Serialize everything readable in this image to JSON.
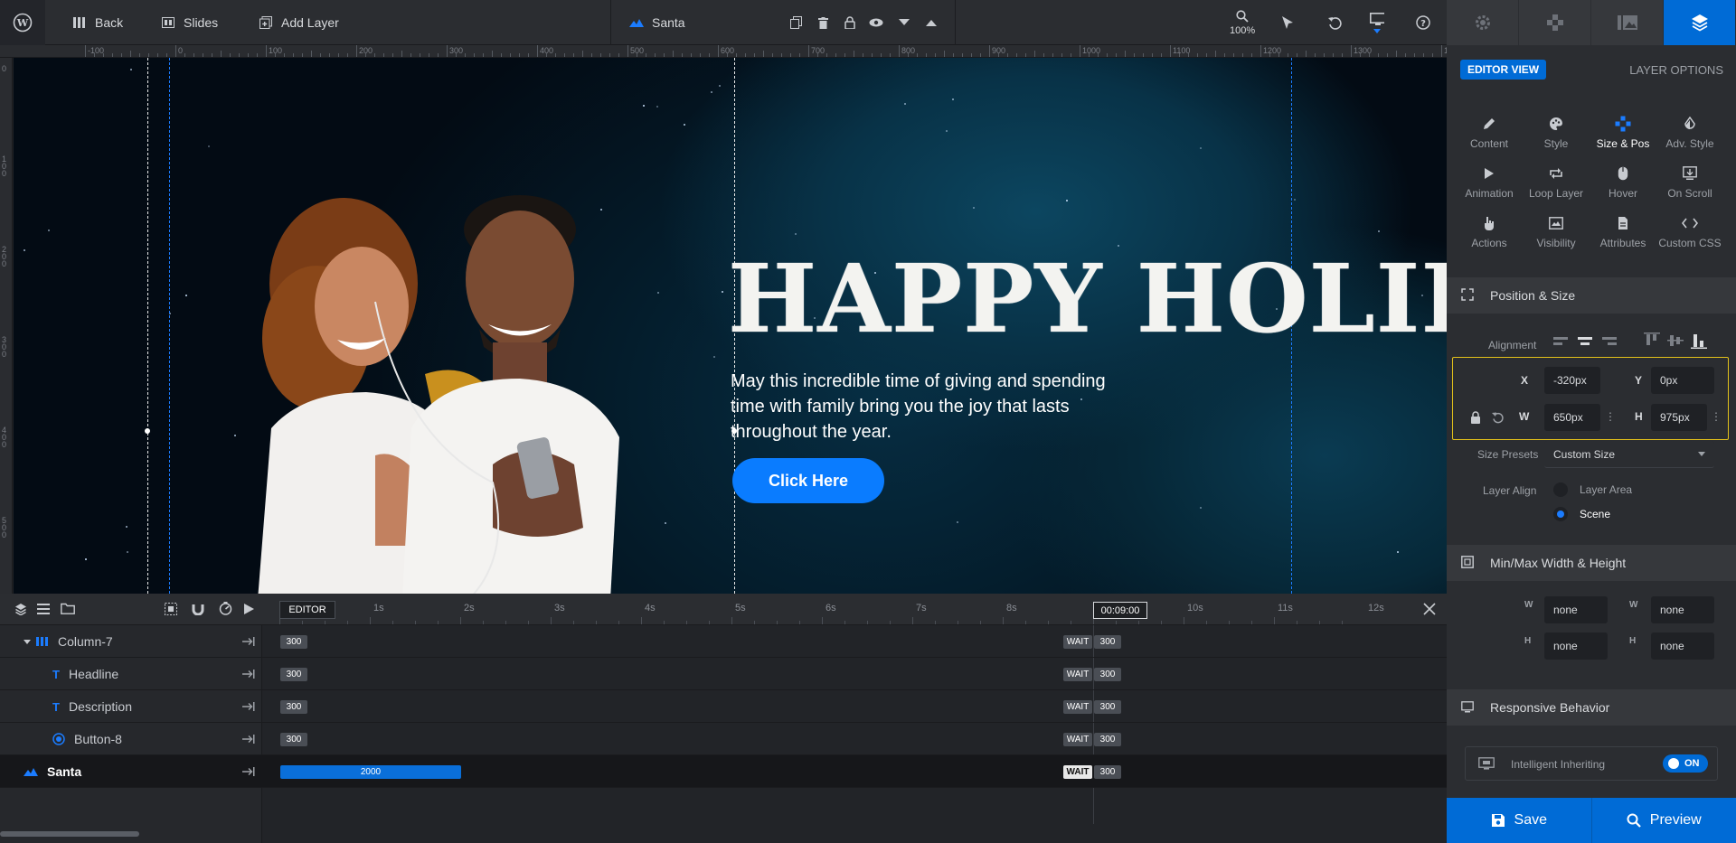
{
  "topbar": {
    "back_label": "Back",
    "slides_label": "Slides",
    "add_layer_label": "Add Layer",
    "current_slide": "Santa",
    "zoom": "100%"
  },
  "right_tabs": [
    "gear-icon",
    "move-icon",
    "gallery-icon",
    "layers-icon"
  ],
  "ruler": {
    "h_labels": [
      "-100",
      "0",
      "100",
      "200",
      "300",
      "400",
      "500",
      "600",
      "700",
      "800",
      "900",
      "1000",
      "1100",
      "1200",
      "1300",
      "14"
    ],
    "v_labels": [
      "0",
      "100",
      "200",
      "300",
      "400",
      "500"
    ]
  },
  "canvas": {
    "headline": "HAPPY HOLIDA",
    "description": "May this incredible time of giving and spending time with family bring you the joy that lasts throughout the year.",
    "button_label": "Click Here"
  },
  "timeline": {
    "editor_label": "EDITOR",
    "time_marks": [
      "1s",
      "2s",
      "3s",
      "4s",
      "5s",
      "6s",
      "7s",
      "8s",
      "9s",
      "10s",
      "11s",
      "12s"
    ],
    "current_time": "00:09:00",
    "rows": [
      {
        "name": "Column-7",
        "start": "300",
        "wait": "WAIT",
        "end": "300"
      },
      {
        "name": "Headline",
        "start": "300",
        "wait": "WAIT",
        "end": "300"
      },
      {
        "name": "Description",
        "start": "300",
        "wait": "WAIT",
        "end": "300"
      },
      {
        "name": "Button-8",
        "start": "300",
        "wait": "WAIT",
        "end": "300"
      },
      {
        "name": "Santa",
        "start": "2000",
        "wait": "WAIT",
        "end": "300"
      }
    ]
  },
  "panel": {
    "editor_view": "EDITOR VIEW",
    "layer_options": "LAYER OPTIONS",
    "tools": [
      {
        "label": "Content",
        "icon": "pencil-icon"
      },
      {
        "label": "Style",
        "icon": "palette-icon"
      },
      {
        "label": "Size & Pos",
        "icon": "size-pos-icon"
      },
      {
        "label": "Adv. Style",
        "icon": "drop-icon"
      },
      {
        "label": "Animation",
        "icon": "play-icon"
      },
      {
        "label": "Loop Layer",
        "icon": "loop-icon"
      },
      {
        "label": "Hover",
        "icon": "mouse-icon"
      },
      {
        "label": "On Scroll",
        "icon": "scroll-icon"
      },
      {
        "label": "Actions",
        "icon": "hand-icon"
      },
      {
        "label": "Visibility",
        "icon": "visibility-icon"
      },
      {
        "label": "Attributes",
        "icon": "file-icon"
      },
      {
        "label": "Custom CSS",
        "icon": "code-icon"
      }
    ],
    "pos_size": {
      "title": "Position & Size",
      "alignment_label": "Alignment",
      "x_label": "X",
      "x_value": "-320px",
      "y_label": "Y",
      "y_value": "0px",
      "w_label": "W",
      "w_value": "650px",
      "h_label": "H",
      "h_value": "975px",
      "size_presets_label": "Size Presets",
      "size_presets_value": "Custom Size",
      "layer_align_label": "Layer Align",
      "layer_area_label": "Layer Area",
      "scene_label": "Scene"
    },
    "minmax": {
      "title": "Min/Max Width & Height",
      "values": [
        "none",
        "none",
        "none",
        "none"
      ]
    },
    "responsive": {
      "title": "Responsive Behavior",
      "inheriting_label": "Intelligent Inheriting",
      "toggle_label": "ON"
    },
    "save_label": "Save",
    "preview_label": "Preview"
  },
  "colors": {
    "accent": "#0a7cff",
    "panel_bg": "#2b2d31",
    "highlight": "#e3c11a"
  }
}
